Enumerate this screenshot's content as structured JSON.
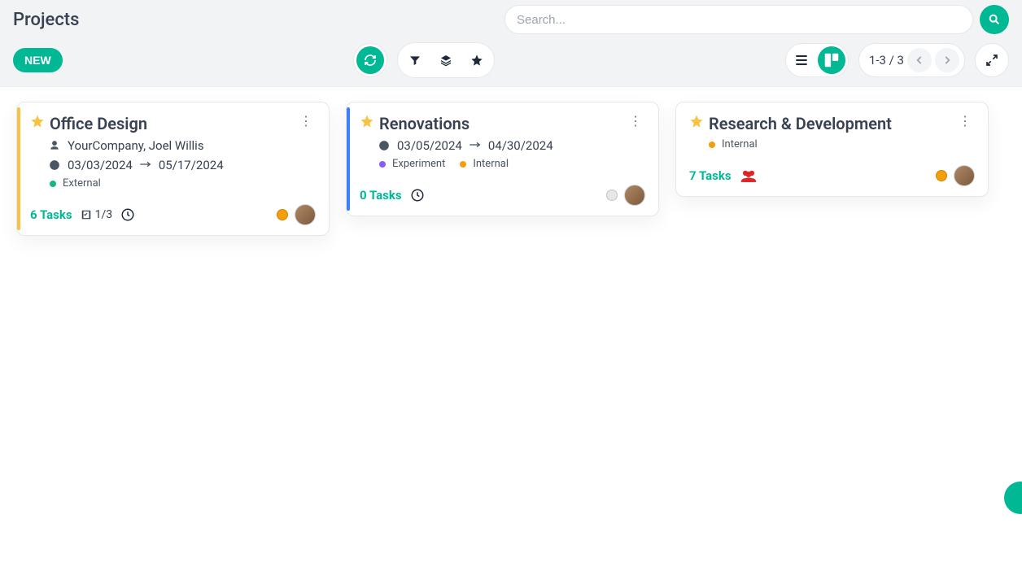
{
  "header": {
    "title": "Projects",
    "search_placeholder": "Search...",
    "new_label": "NEW",
    "pager_text": "1-3 / 3"
  },
  "colors": {
    "accent": "#00b894",
    "star": "#f6c344"
  },
  "cards": [
    {
      "stripe_color": "#f6c344",
      "title": "Office Design",
      "owner": "YourCompany, Joel Willis",
      "date_start": "03/03/2024",
      "date_end": "05/17/2024",
      "tags": [
        {
          "label": "External",
          "color": "#10b981"
        }
      ],
      "tasks_label": "6 Tasks",
      "milestone_text": "1/3",
      "show_milestone": true,
      "show_clock": true,
      "show_group": false,
      "status_color": "#f59e0b"
    },
    {
      "stripe_color": "#3b82f6",
      "title": "Renovations",
      "owner": "",
      "date_start": "03/05/2024",
      "date_end": "04/30/2024",
      "tags": [
        {
          "label": "Experiment",
          "color": "#8b5cf6"
        },
        {
          "label": "Internal",
          "color": "#f59e0b"
        }
      ],
      "tasks_label": "0 Tasks",
      "milestone_text": "",
      "show_milestone": false,
      "show_clock": true,
      "show_group": false,
      "status_color": "#e5e7eb"
    },
    {
      "stripe_color": "#ffffff",
      "title": "Research & Development",
      "owner": "",
      "date_start": "",
      "date_end": "",
      "tags": [
        {
          "label": "Internal",
          "color": "#f59e0b"
        }
      ],
      "tasks_label": "7 Tasks",
      "milestone_text": "",
      "show_milestone": false,
      "show_clock": false,
      "show_group": true,
      "status_color": "#f59e0b"
    }
  ]
}
